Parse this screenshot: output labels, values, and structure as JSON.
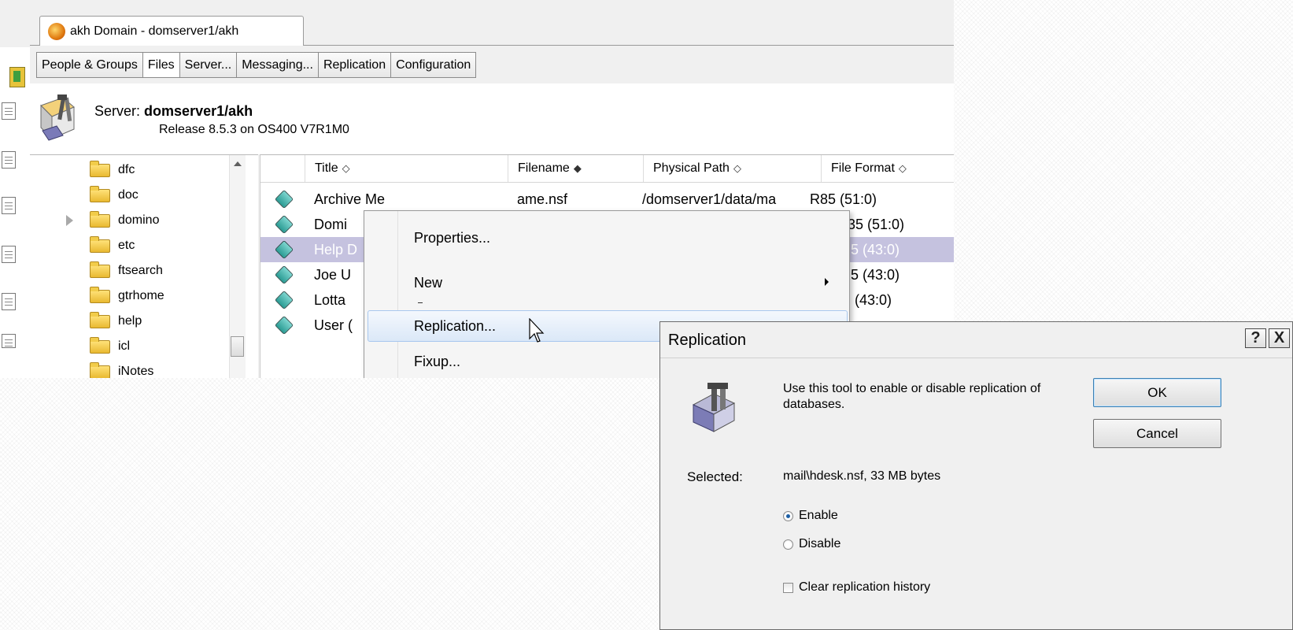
{
  "window": {
    "tab_title": "akh Domain - domserver1/akh"
  },
  "tabs": [
    {
      "label": "People & Groups"
    },
    {
      "label": "Files"
    },
    {
      "label": "Server..."
    },
    {
      "label": "Messaging..."
    },
    {
      "label": "Replication"
    },
    {
      "label": "Configuration"
    }
  ],
  "server": {
    "label": "Server:",
    "name": "domserver1/akh",
    "release": "Release 8.5.3 on OS400 V7R1M0"
  },
  "tree": {
    "items": [
      "dfc",
      "doc",
      "domino",
      "etc",
      "ftsearch",
      "gtrhome",
      "help",
      "icl",
      "iNotes"
    ]
  },
  "filelist": {
    "columns": [
      "Title",
      "Filename",
      "Physical Path",
      "File Format"
    ],
    "rows": [
      {
        "title": "Archive Me",
        "filename": "ame.nsf",
        "path": "/domserver1/data/ma",
        "format": "R85 (51:0)"
      },
      {
        "title": "Domi",
        "filename": "",
        "path": "",
        "format": "35 (51:0)"
      },
      {
        "title": "Help D",
        "filename": "",
        "path": "",
        "format": "5 (43:0)"
      },
      {
        "title": "Joe U",
        "filename": "",
        "path": "",
        "format": "5 (43:0)"
      },
      {
        "title": "Lotta",
        "filename": "",
        "path": "",
        "format": "(43:0)"
      },
      {
        "title": "User (",
        "filename": "",
        "path": "",
        "format": ""
      }
    ],
    "selected_row": 2,
    "accent_selected": "#c5c2df"
  },
  "context_menu": {
    "items": [
      "Properties...",
      "New",
      "Replication...",
      "Fixup..."
    ]
  },
  "dialog": {
    "title": "Replication",
    "help_btn": "?",
    "close_btn": "X",
    "description": "Use this tool to enable or disable replication of databases.",
    "ok": "OK",
    "cancel": "Cancel",
    "selected_label": "Selected:",
    "selected_value": "mail\\hdesk.nsf, 33 MB bytes",
    "enable_label": "Enable",
    "disable_label": "Disable",
    "enable_checked": true,
    "clear_history_label": "Clear replication history",
    "clear_history_checked": false
  },
  "icons": [
    "folder-icon",
    "database-icon",
    "server-tools-icon",
    "domino-logo-icon",
    "mouse-pointer-icon"
  ]
}
